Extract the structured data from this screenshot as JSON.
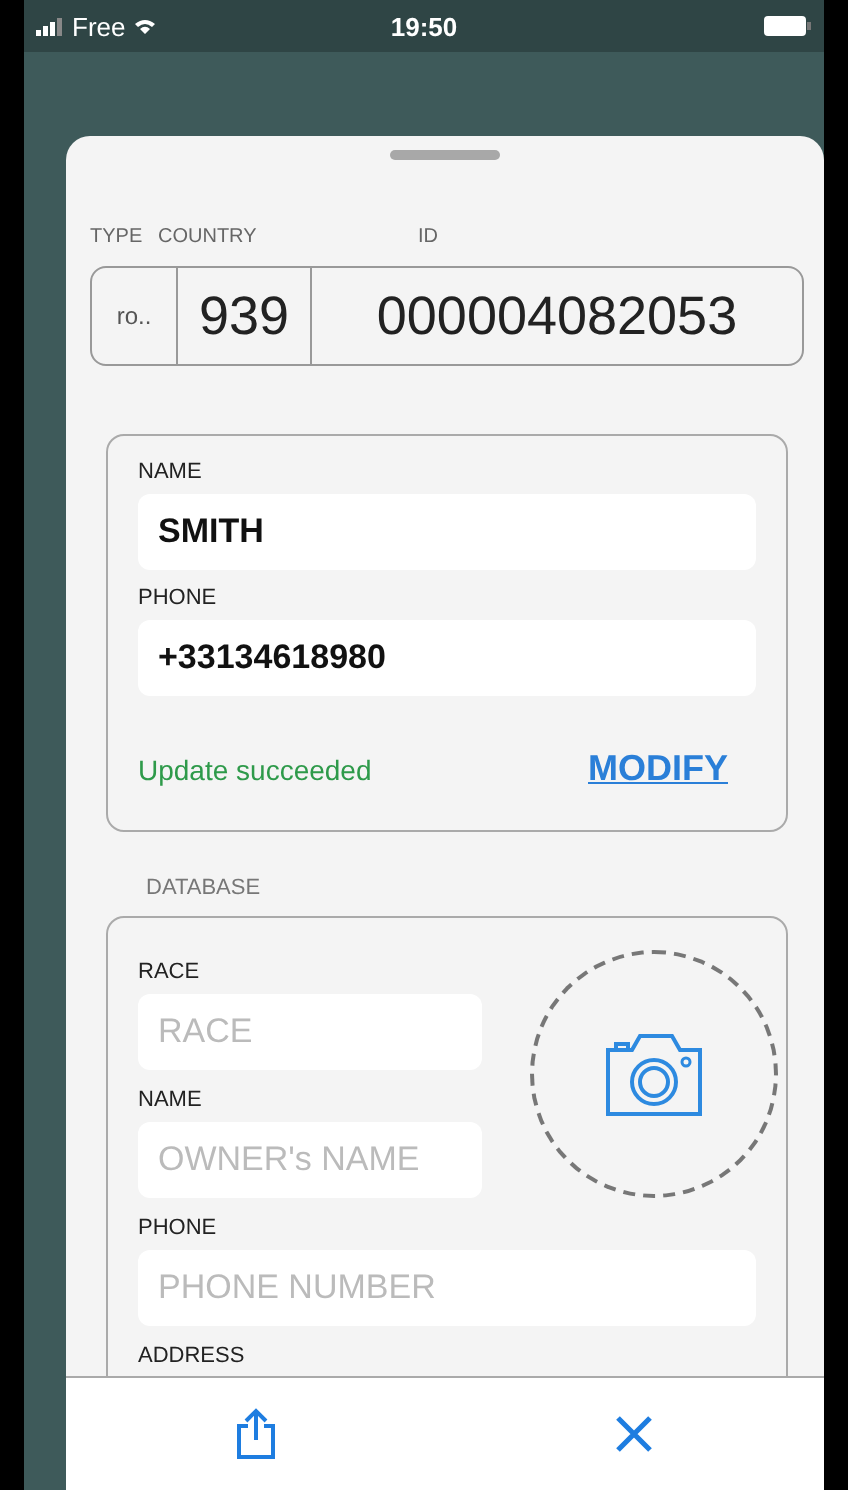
{
  "status_bar": {
    "carrier": "Free",
    "time": "19:50"
  },
  "identifier": {
    "labels": [
      "TYPE",
      "COUNTRY",
      "ID"
    ],
    "segments": [
      "ro..",
      "939",
      "000004082053"
    ]
  },
  "contact": {
    "fields": [
      {
        "label": "NAME",
        "value": "SMITH"
      },
      {
        "label": "PHONE",
        "value": "+33134618980"
      }
    ],
    "message": "Update succeeded",
    "action": "MODIFY"
  },
  "database": {
    "title": "DATABASE",
    "fields": [
      {
        "label": "RACE",
        "placeholder": "RACE",
        "kind": "short"
      },
      {
        "label": "NAME",
        "placeholder": "OWNER's NAME",
        "kind": "short"
      },
      {
        "label": "PHONE",
        "placeholder": "PHONE NUMBER",
        "kind": "wide"
      },
      {
        "label": "ADDRESS",
        "kind": "label"
      }
    ]
  }
}
